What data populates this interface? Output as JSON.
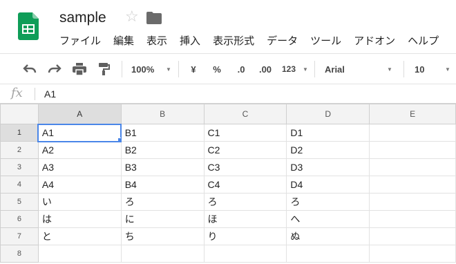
{
  "document": {
    "title": "sample"
  },
  "menu": [
    {
      "label": "ファイル",
      "id": "file"
    },
    {
      "label": "編集",
      "id": "edit"
    },
    {
      "label": "表示",
      "id": "view"
    },
    {
      "label": "挿入",
      "id": "insert"
    },
    {
      "label": "表示形式",
      "id": "format"
    },
    {
      "label": "データ",
      "id": "data"
    },
    {
      "label": "ツール",
      "id": "tools"
    },
    {
      "label": "アドオン",
      "id": "addons"
    },
    {
      "label": "ヘルプ",
      "id": "help"
    }
  ],
  "toolbar": {
    "zoom": "100%",
    "currency": "¥",
    "percent": "%",
    "decrease_decimal": ".0",
    "increase_decimal": ".00",
    "more_formats": "123",
    "font": "Arial",
    "font_size": "10"
  },
  "formula_bar": {
    "fx_label": "fx",
    "value": "A1"
  },
  "sheet": {
    "columns": [
      "A",
      "B",
      "C",
      "D",
      "E"
    ],
    "rows": [
      {
        "num": "1",
        "cells": [
          "A1",
          "B1",
          "C1",
          "D1",
          ""
        ]
      },
      {
        "num": "2",
        "cells": [
          "A2",
          "B2",
          "C2",
          "D2",
          ""
        ]
      },
      {
        "num": "3",
        "cells": [
          "A3",
          "B3",
          "C3",
          "D3",
          ""
        ]
      },
      {
        "num": "4",
        "cells": [
          "A4",
          "B4",
          "C4",
          "D4",
          ""
        ]
      },
      {
        "num": "5",
        "cells": [
          "い",
          "ろ",
          "ろ",
          "ろ",
          ""
        ]
      },
      {
        "num": "6",
        "cells": [
          "は",
          "に",
          "ほ",
          "へ",
          ""
        ]
      },
      {
        "num": "7",
        "cells": [
          "と",
          "ち",
          "り",
          "ぬ",
          ""
        ]
      },
      {
        "num": "8",
        "cells": [
          "",
          "",
          "",
          "",
          ""
        ]
      }
    ],
    "selected_cell": "A1"
  },
  "colors": {
    "sheets_green": "#0f9d58",
    "selection_blue": "#4a86e8"
  },
  "icons": {
    "logo": "sheets-logo-icon",
    "star": "star-icon",
    "folder": "folder-icon",
    "undo": "undo-icon",
    "redo": "redo-icon",
    "print": "print-icon",
    "paint_format": "paint-format-icon"
  }
}
